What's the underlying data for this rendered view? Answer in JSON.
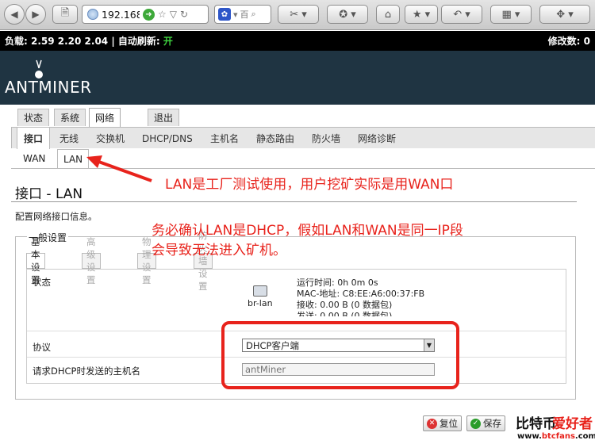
{
  "browser": {
    "url": "192.168",
    "search_label": "百"
  },
  "status_bar": {
    "load_text": "负载: 2.59 2.20 2.04",
    "separator": "|",
    "auto_refresh_label": "自动刷新:",
    "auto_refresh_value": "开",
    "changes_text": "修改数: 0"
  },
  "brand": {
    "logo": "ANTMINER"
  },
  "top_tabs": [
    "状态",
    "系统",
    "网络",
    "退出"
  ],
  "sub_tabs": [
    "接口",
    "无线",
    "交换机",
    "DHCP/DNS",
    "主机名",
    "静态路由",
    "防火墙",
    "网络诊断"
  ],
  "iface_tabs": [
    "WAN",
    "LAN"
  ],
  "page": {
    "title": "接口 - LAN",
    "description": "配置网络接口信息。"
  },
  "fieldset": {
    "legend": "一般设置",
    "tabs": [
      "基本设置",
      "高级设置",
      "物理设置",
      "防火墙设置"
    ],
    "status_label": "状态",
    "device_name": "br-lan",
    "status_lines": [
      "运行时间: 0h 0m 0s",
      "MAC-地址: C8:EE:A6:00:37:FB",
      "接收: 0.00 B (0 数据包)",
      "发送: 0.00 B (0 数据包)"
    ],
    "protocol_label": "协议",
    "protocol_value": "DHCP客户端",
    "hostname_label": "请求DHCP时发送的主机名",
    "hostname_placeholder": "antMiner"
  },
  "buttons": {
    "reset": "复位",
    "save": "保存"
  },
  "annotations": {
    "note1": "LAN是工厂测试使用，用户挖矿实际是用WAN口",
    "note2_line1": "务必确认LAN是DHCP，假如LAN和WAN是同一IP段",
    "note2_line2": "会导致无法进入矿机。"
  },
  "watermark": {
    "part1": "比特币",
    "part2": "爱好者",
    "url_prefix": "www.",
    "url_main": "btcfans",
    "url_suffix": ".com"
  },
  "colors": {
    "annotation": "#e8231c",
    "header_bg": "#1f3442",
    "status_bg": "#000000",
    "status_on": "#3fd23f"
  }
}
